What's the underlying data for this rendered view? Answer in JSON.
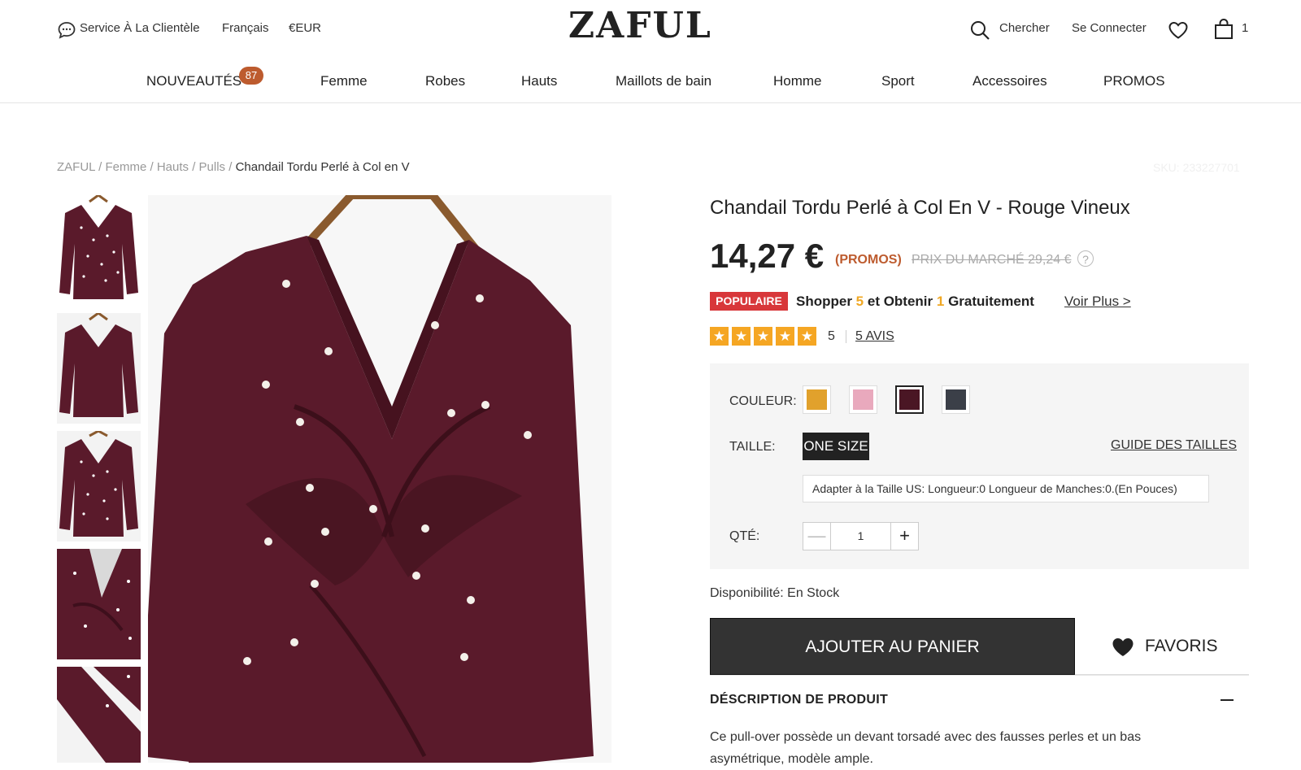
{
  "topbar": {
    "service_label": "Service À La Clientèle",
    "language": "Français",
    "currency": "€EUR",
    "logo": "ZAFUL",
    "search_label": "Chercher",
    "login_label": "Se Connecter",
    "cart_count": "1"
  },
  "nav": {
    "items": [
      "NOUVEAUTÉS",
      "Femme",
      "Robes",
      "Hauts",
      "Maillots de bain",
      "Homme",
      "Sport",
      "Accessoires",
      "PROMOS"
    ],
    "new_badge": "87"
  },
  "breadcrumb": {
    "items": [
      "ZAFUL",
      "Femme",
      "Hauts",
      "Pulls"
    ],
    "separator": "/",
    "current": "Chandail Tordu Perlé à Col en V"
  },
  "sku": "SKU: 233227701",
  "product": {
    "title": "Chandail Tordu Perlé à Col En V - Rouge Vineux",
    "price": "14,27 €",
    "promo_tag": "(PROMOS)",
    "market_price": "PRIX DU MARCHÉ 29,24 €",
    "help_icon": "?",
    "badge": "POPULAIRE",
    "deal": {
      "part1": "Shopper ",
      "n1": "5",
      "part2": " et Obtenir ",
      "n2": "1",
      "part3": " Gratuitement"
    },
    "voir_plus": "Voir Plus >",
    "rating": "5",
    "reviews": "5 AVIS",
    "star_glyph": "★"
  },
  "options": {
    "color_label": "COULEUR:",
    "colors": [
      {
        "name": "mustard",
        "hex": "#e1a12c"
      },
      {
        "name": "pink",
        "hex": "#e9a9bd"
      },
      {
        "name": "wine",
        "hex": "#4a1624"
      },
      {
        "name": "charcoal",
        "hex": "#3b3f48"
      }
    ],
    "selected_color": 2,
    "size_label": "TAILLE:",
    "size_value": "ONE SIZE",
    "size_guide": "GUIDE DES TAILLES",
    "fit_note": "Adapter à la Taille US:   Longueur:0   Longueur de Manches:0.(En Pouces)",
    "qty_label": "QTÉ:",
    "qty_minus": "—",
    "qty_value": "1",
    "qty_plus": "+"
  },
  "availability": "Disponibilité: En Stock",
  "actions": {
    "add_to_cart": "AJOUTER AU PANIER",
    "favorites": "FAVORIS"
  },
  "description": {
    "title": "DÉSCRIPTION DE PRODUIT",
    "text": "Ce pull-over possède un devant torsadé avec des fausses perles et un bas asymétrique, modèle ample."
  },
  "colors": {
    "accent": "#bd5b2e",
    "popular_red": "#d8373a",
    "star": "#f5a623",
    "garment": "#5a1a2b"
  }
}
